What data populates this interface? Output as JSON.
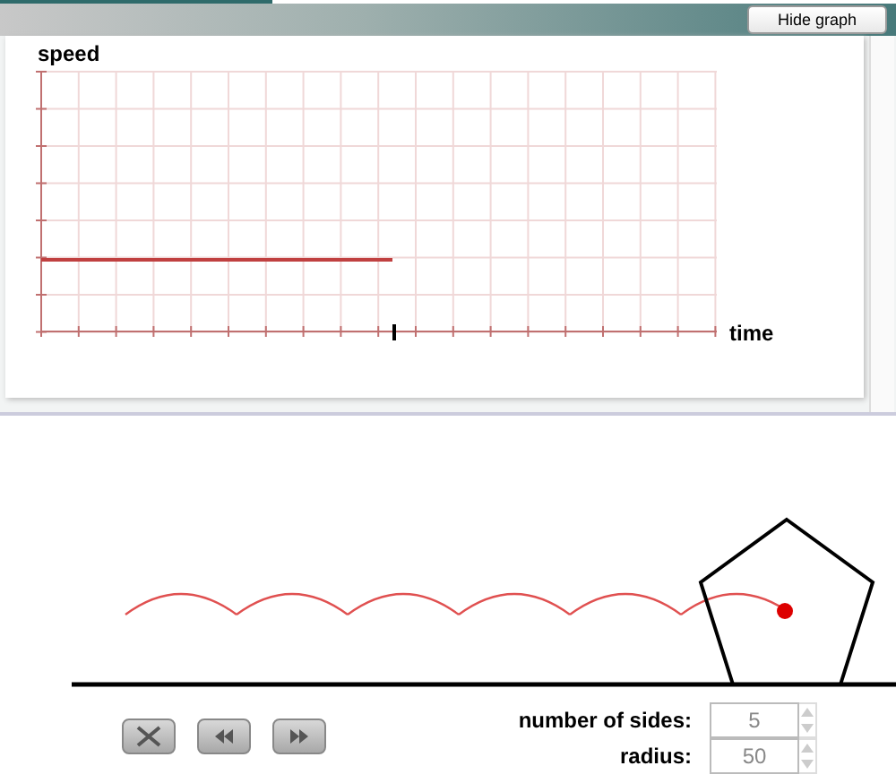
{
  "header": {
    "button": "Hide graph"
  },
  "graph": {
    "ylabel": "speed",
    "xlabel": "time"
  },
  "buttons": [
    {
      "kind": "stop"
    },
    {
      "kind": "rewind"
    },
    {
      "kind": "forward"
    }
  ],
  "fields": [
    {
      "label": "number of sides:",
      "value": "5"
    },
    {
      "label": "radius:",
      "value": "50"
    }
  ]
}
